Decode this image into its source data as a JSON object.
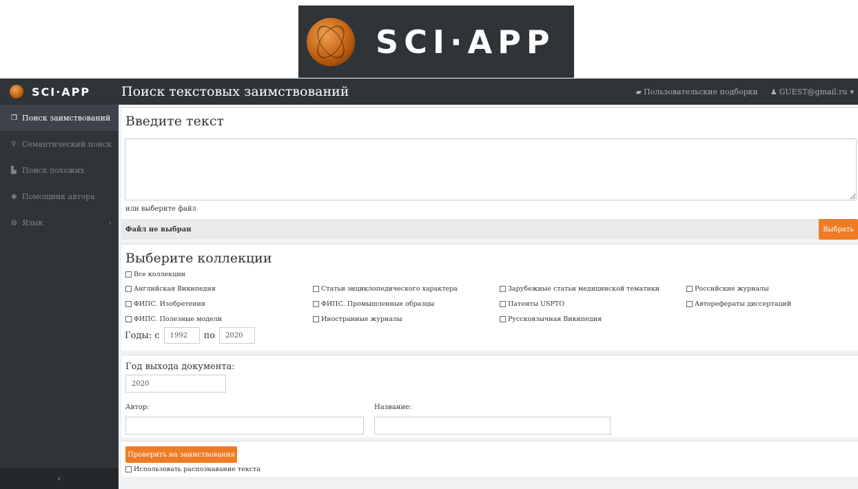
{
  "banner": {
    "logo_text": "SCI·APP"
  },
  "header": {
    "logo_text": "SCI·APP",
    "title": "Поиск текстовых заимствований",
    "collections_link": "Пользовательские подборки",
    "user": "GUEST@gmail.ru"
  },
  "sidebar": {
    "items": [
      {
        "label": "Поиск заимствований",
        "icon": "copy-icon"
      },
      {
        "label": "Семантический поиск",
        "icon": "search-icon"
      },
      {
        "label": "Поиск похожих",
        "icon": "file-icon"
      },
      {
        "label": "Помощник автора",
        "icon": "eye-icon"
      },
      {
        "label": "Язык",
        "icon": "globe-icon"
      }
    ],
    "collapse": "‹"
  },
  "text_panel": {
    "heading": "Введите текст",
    "textarea_value": "",
    "or_file": "или выберите файл",
    "file_status": "Файл не выбран",
    "choose_button": "Выбрать"
  },
  "collections": {
    "heading": "Выберите коллекции",
    "all": "Все коллекции",
    "items": [
      "Английская Википедия",
      "Статьи энциклопедического характера",
      "Зарубежные статьи медицинской тематики",
      "Российские журналы",
      "ФИПС. Изобретения",
      "ФИПС. Промышленные образцы",
      "Патенты USPTO",
      "Авторефераты диссертаций",
      "ФИПС. Полезные модели",
      "Иностранные журналы",
      "Русскоязычная Википедия"
    ],
    "years_label": "Годы: с",
    "year_from": "1992",
    "to_label": "по",
    "year_to": "2020"
  },
  "filters": {
    "year_label": "Год выхода документа:",
    "year_value": "2020",
    "author_label": "Автор:",
    "author_value": "",
    "title_label": "Название:",
    "title_value": ""
  },
  "actions": {
    "check_button": "Проверить на заимствования",
    "ocr_label": "Использовать распознавание текста"
  },
  "colors": {
    "accent": "#ee7b26",
    "dark": "#2f3438"
  }
}
